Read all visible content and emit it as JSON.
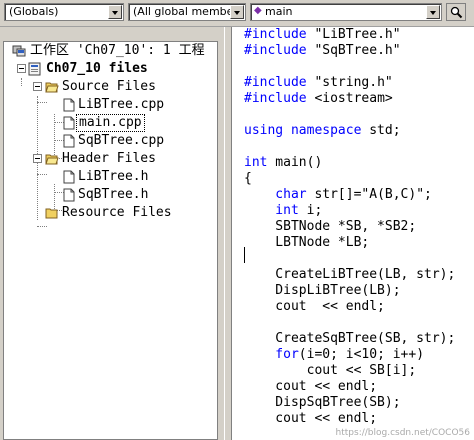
{
  "toolbar": {
    "scope_combo": "(Globals)",
    "members_combo": "(All global members",
    "function_combo": "main",
    "function_icon": "purple-diamond-icon",
    "find_icon": "find-icon"
  },
  "workspace": {
    "title": "工作区 'Ch07_10': 1 工程",
    "project": "Ch07_10 files",
    "source_folder": "Source Files",
    "source_files": [
      "LiBTree.cpp",
      "main.cpp",
      "SqBTree.cpp"
    ],
    "header_folder": "Header Files",
    "header_files": [
      "LiBTree.h",
      "SqBTree.h"
    ],
    "resource_folder": "Resource Files",
    "selected_file": "main.cpp"
  },
  "editor": {
    "lines": [
      {
        "kw": "#include",
        "rest": " \"LiBTree.h\""
      },
      {
        "kw": "#include",
        "rest": " \"SqBTree.h\""
      },
      {
        "kw": "",
        "rest": ""
      },
      {
        "kw": "#include",
        "rest": " \"string.h\""
      },
      {
        "kw": "#include",
        "rest": " <iostream>"
      },
      {
        "kw": "",
        "rest": ""
      },
      {
        "kw": "using namespace",
        "rest": " std;"
      },
      {
        "kw": "",
        "rest": ""
      },
      {
        "kw": "int",
        "rest": " main()"
      },
      {
        "kw": "",
        "rest": "{"
      },
      {
        "kw": "    char",
        "rest": " str[]=\"A(B,C)\";"
      },
      {
        "kw": "    int",
        "rest": " i;"
      },
      {
        "kw": "",
        "rest": "    SBTNode *SB, *SB2;"
      },
      {
        "kw": "",
        "rest": "    LBTNode *LB;"
      },
      {
        "kw": "",
        "rest": ""
      },
      {
        "kw": "",
        "rest": "    CreateLiBTree(LB, str);"
      },
      {
        "kw": "",
        "rest": "    DispLiBTree(LB);"
      },
      {
        "kw": "",
        "rest": "    cout  << endl;"
      },
      {
        "kw": "",
        "rest": ""
      },
      {
        "kw": "",
        "rest": "    CreateSqBTree(SB, str);"
      },
      {
        "kw": "    for",
        "rest": "(i=0; i<10; i++)"
      },
      {
        "kw": "",
        "rest": "        cout << SB[i];"
      },
      {
        "kw": "",
        "rest": "    cout << endl;"
      },
      {
        "kw": "",
        "rest": "    DispSqBTree(SB);"
      },
      {
        "kw": "",
        "rest": "    cout << endl;"
      }
    ],
    "watermark": "https://blog.csdn.net/COCO56"
  },
  "colors": {
    "keyword": "#0000ff",
    "chrome": "#d4d0c8"
  }
}
